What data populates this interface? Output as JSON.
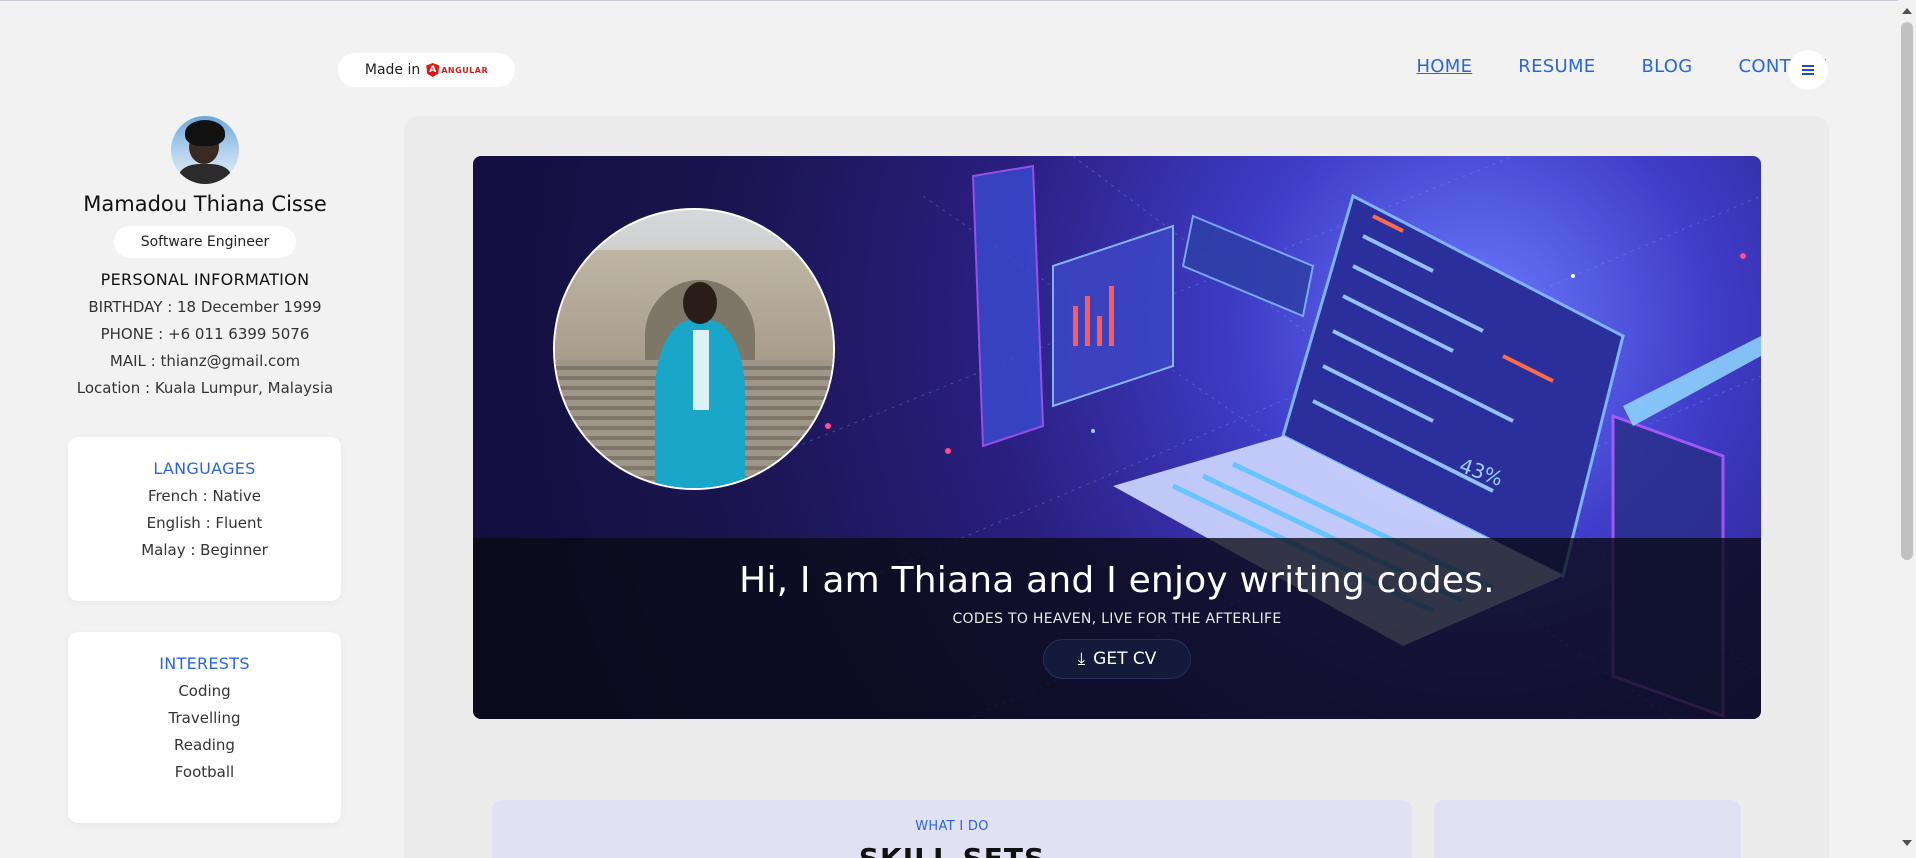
{
  "badge": {
    "made_in": "Made in",
    "framework": "ANGULAR"
  },
  "nav": {
    "items": [
      "HOME",
      "RESUME",
      "BLOG",
      "CONTACT"
    ],
    "active": "HOME",
    "menu_icon": "hamburger-icon"
  },
  "profile": {
    "name": "Mamadou Thiana Cisse",
    "role": "Software Engineer",
    "section_title": "PERSONAL INFORMATION",
    "birthday": "BIRTHDAY : 18 December 1999",
    "phone": "PHONE : +6 011 6399 5076",
    "mail": "MAIL : thianz@gmail.com",
    "location": "Location : Kuala Lumpur, Malaysia"
  },
  "languages": {
    "title": "LANGUAGES",
    "items": [
      "French : Native",
      "English : Fluent",
      "Malay : Beginner"
    ]
  },
  "interests": {
    "title": "INTERESTS",
    "items": [
      "Coding",
      "Travelling",
      "Reading",
      "Football"
    ]
  },
  "hero": {
    "title": "Hi, I am Thiana and I enjoy writing codes.",
    "subtitle": "CODES TO HEAVEN, LIVE FOR THE AFTERLIFE",
    "button": "GET CV",
    "button_icon": "download-icon"
  },
  "skills": {
    "eyebrow": "WHAT I DO",
    "title": "SKILL SETS"
  },
  "colors": {
    "accent": "#2a66d9",
    "background": "#f2f2f2",
    "hero_overlay": "#0a0a14"
  }
}
